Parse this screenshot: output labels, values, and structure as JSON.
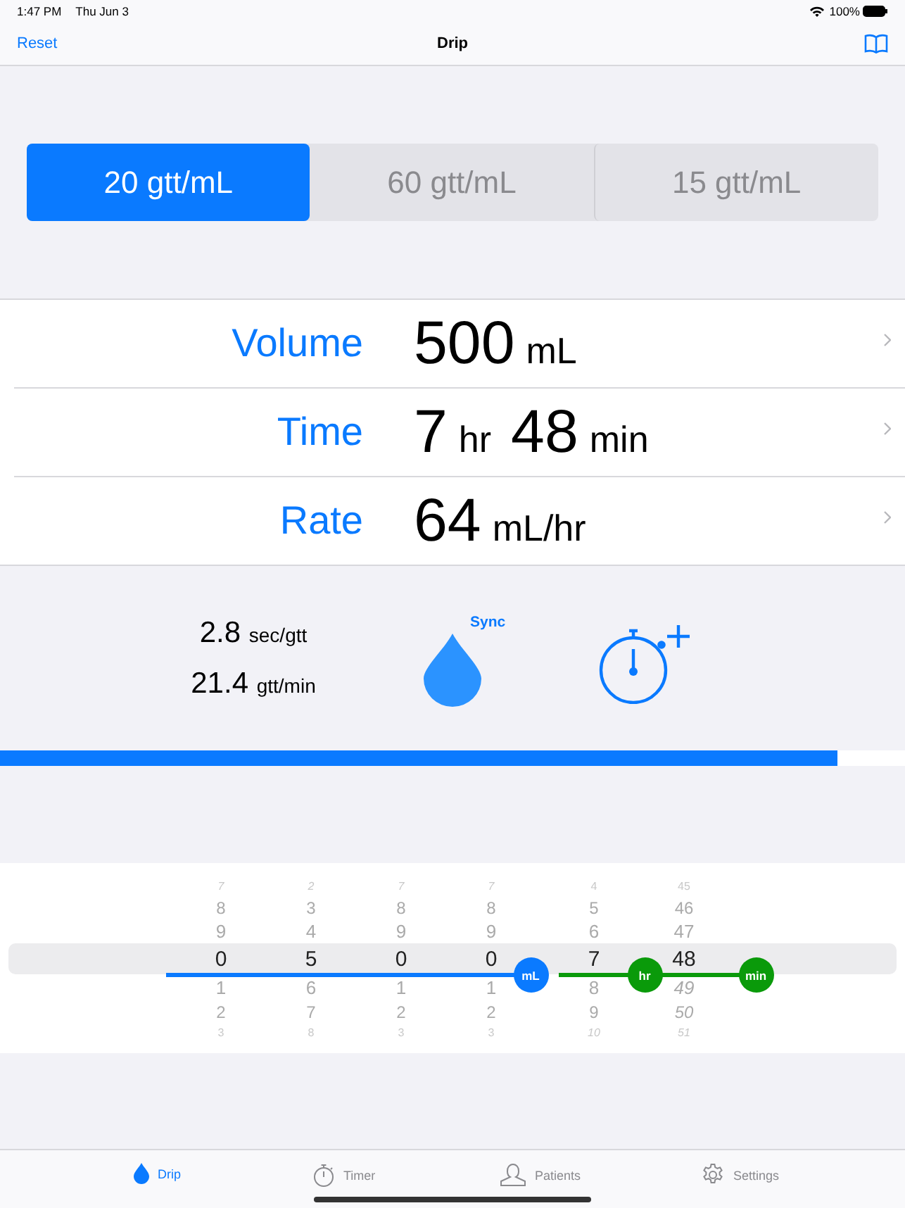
{
  "status_bar": {
    "time": "1:47 PM",
    "date": "Thu Jun 3",
    "battery": "100%"
  },
  "nav": {
    "left_button": "Reset",
    "title": "Drip"
  },
  "segments": [
    {
      "label": "20 gtt/mL",
      "selected": true
    },
    {
      "label": "60 gtt/mL",
      "selected": false
    },
    {
      "label": "15 gtt/mL",
      "selected": false
    }
  ],
  "fields": [
    {
      "label": "Volume",
      "parts": [
        {
          "value": "500",
          "unit": "mL"
        }
      ]
    },
    {
      "label": "Time",
      "parts": [
        {
          "value": "7",
          "unit": "hr"
        },
        {
          "value": "48",
          "unit": "min"
        }
      ]
    },
    {
      "label": "Rate",
      "parts": [
        {
          "value": "64",
          "unit": "mL/hr"
        }
      ]
    }
  ],
  "rates": [
    {
      "value": "2.8",
      "unit": "sec/gtt"
    },
    {
      "value": "21.4",
      "unit": "gtt/min"
    }
  ],
  "sync_label": "Sync",
  "progress": {
    "level": 0.925
  },
  "picker": {
    "columns": [
      {
        "rows": [
          {
            "text": "7",
            "selected": false
          },
          {
            "text": "8",
            "selected": false
          },
          {
            "text": "9",
            "selected": false
          },
          {
            "text": "0",
            "selected": true
          },
          {
            "text": "1",
            "selected": false
          },
          {
            "text": "2",
            "selected": false
          },
          {
            "text": "3",
            "selected": false
          }
        ]
      },
      {
        "rows": [
          {
            "text": "2",
            "selected": false
          },
          {
            "text": "3",
            "selected": false
          },
          {
            "text": "4",
            "selected": false
          },
          {
            "text": "5",
            "selected": true
          },
          {
            "text": "6",
            "selected": false
          },
          {
            "text": "7",
            "selected": false
          },
          {
            "text": "8",
            "selected": false
          }
        ]
      },
      {
        "rows": [
          {
            "text": "7",
            "selected": false
          },
          {
            "text": "8",
            "selected": false
          },
          {
            "text": "9",
            "selected": false
          },
          {
            "text": "0",
            "selected": true
          },
          {
            "text": "1",
            "selected": false
          },
          {
            "text": "2",
            "selected": false
          },
          {
            "text": "3",
            "selected": false
          }
        ]
      },
      {
        "rows": [
          {
            "text": "7",
            "selected": false
          },
          {
            "text": "8",
            "selected": false
          },
          {
            "text": "9",
            "selected": false
          },
          {
            "text": "0",
            "selected": true
          },
          {
            "text": "1",
            "selected": false
          },
          {
            "text": "2",
            "selected": false
          },
          {
            "text": "3",
            "selected": false
          }
        ]
      },
      {
        "rows": [
          {
            "text": "4",
            "selected": false
          },
          {
            "text": "5",
            "selected": false
          },
          {
            "text": "6",
            "selected": false
          },
          {
            "text": "7",
            "selected": true
          },
          {
            "text": "8",
            "selected": false
          },
          {
            "text": "9",
            "selected": false
          },
          {
            "text": "10",
            "selected": false
          }
        ]
      },
      {
        "rows": [
          {
            "text": "45",
            "selected": false
          },
          {
            "text": "46",
            "selected": false
          },
          {
            "text": "47",
            "selected": false
          },
          {
            "text": "48",
            "selected": true
          },
          {
            "text": "49",
            "selected": false
          },
          {
            "text": "50",
            "selected": false
          },
          {
            "text": "51",
            "selected": false
          }
        ]
      }
    ],
    "markers": [
      {
        "label": "mL",
        "color": "#0a7aff"
      },
      {
        "label": "hr",
        "color": "#0a9a0a"
      },
      {
        "label": "min",
        "color": "#0a9a0a"
      }
    ]
  },
  "tabs": [
    {
      "label": "Drip",
      "selected": true
    },
    {
      "label": "Timer",
      "selected": false
    },
    {
      "label": "Patients",
      "selected": false
    },
    {
      "label": "Settings",
      "selected": false
    }
  ]
}
